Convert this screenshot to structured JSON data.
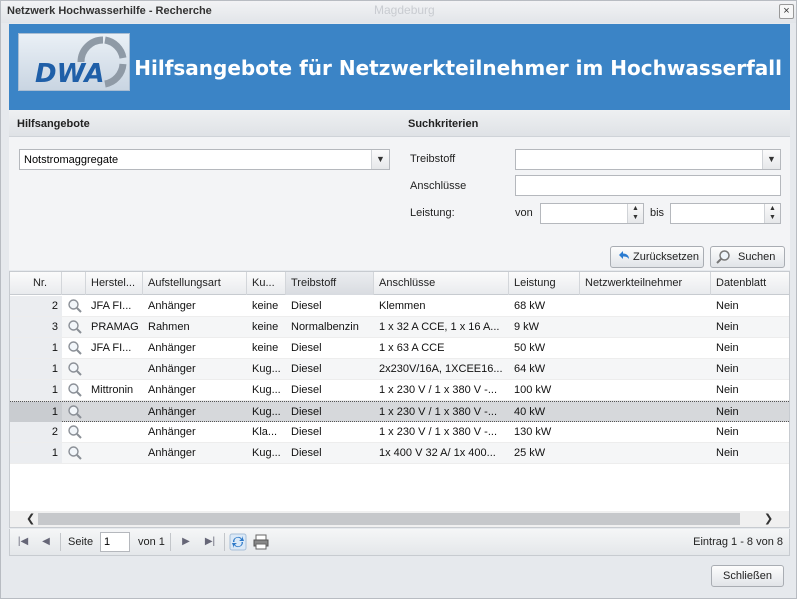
{
  "window": {
    "title": "Netzwerk Hochwasserhilfe - Recherche",
    "background_city": "Magdeburg",
    "close_label": "×"
  },
  "banner": {
    "logo_text": "DWA",
    "title": "Hilfsangebote für Netzwerkteilnehmer im Hochwasserfall"
  },
  "hilfsangebote": {
    "header": "Hilfsangebote",
    "selected": "Notstromaggregate"
  },
  "suchkriterien": {
    "header": "Suchkriterien",
    "treibstoff_label": "Treibstoff",
    "treibstoff_value": "",
    "anschluesse_label": "Anschlüsse",
    "anschluesse_value": "",
    "leistung_label": "Leistung:",
    "von_label": "von",
    "bis_label": "bis",
    "von_value": "",
    "bis_value": ""
  },
  "buttons": {
    "reset": "Zurücksetzen",
    "search": "Suchen",
    "close": "Schließen"
  },
  "grid": {
    "columns": [
      "Nr.",
      "",
      "Herstel...",
      "Aufstellungsart",
      "Ku...",
      "Treibstoff",
      "Anschlüsse",
      "Leistung",
      "Netzwerkteilnehmer",
      "Datenblatt"
    ],
    "rows": [
      {
        "nr": "2",
        "hersteller": "JFA FI...",
        "aufstellung": "Anhänger",
        "ku": "keine",
        "treibstoff": "Diesel",
        "anschluesse": "Klemmen",
        "leistung": "68 kW",
        "teilnehmer": "",
        "datenblatt": "Nein"
      },
      {
        "nr": "3",
        "hersteller": "PRAMAG",
        "aufstellung": "Rahmen",
        "ku": "keine",
        "treibstoff": "Normalbenzin",
        "anschluesse": "1 x 32 A CCE, 1 x 16 A...",
        "leistung": "9 kW",
        "teilnehmer": "",
        "datenblatt": "Nein"
      },
      {
        "nr": "1",
        "hersteller": "JFA FI...",
        "aufstellung": "Anhänger",
        "ku": "keine",
        "treibstoff": "Diesel",
        "anschluesse": "1 x 63 A CCE",
        "leistung": "50 kW",
        "teilnehmer": "",
        "datenblatt": "Nein"
      },
      {
        "nr": "1",
        "hersteller": "",
        "aufstellung": "Anhänger",
        "ku": "Kug...",
        "treibstoff": "Diesel",
        "anschluesse": "2x230V/16A, 1XCEE16...",
        "leistung": "64 kW",
        "teilnehmer": "",
        "datenblatt": "Nein"
      },
      {
        "nr": "1",
        "hersteller": "Mittronin",
        "aufstellung": "Anhänger",
        "ku": "Kug...",
        "treibstoff": "Diesel",
        "anschluesse": "1 x 230 V / 1 x 380 V -...",
        "leistung": "100 kW",
        "teilnehmer": "",
        "datenblatt": "Nein"
      },
      {
        "nr": "1",
        "hersteller": "",
        "aufstellung": "Anhänger",
        "ku": "Kug...",
        "treibstoff": "Diesel",
        "anschluesse": "1 x 230 V / 1 x 380 V -...",
        "leistung": "40 kW",
        "teilnehmer": "",
        "datenblatt": "Nein"
      },
      {
        "nr": "2",
        "hersteller": "",
        "aufstellung": "Anhänger",
        "ku": "Kla...",
        "treibstoff": "Diesel",
        "anschluesse": "1 x 230 V / 1 x 380 V -...",
        "leistung": "130 kW",
        "teilnehmer": "",
        "datenblatt": "Nein"
      },
      {
        "nr": "1",
        "hersteller": "",
        "aufstellung": "Anhänger",
        "ku": "Kug...",
        "treibstoff": "Diesel",
        "anschluesse": "1x 400 V 32 A/ 1x 400...",
        "leistung": "25 kW",
        "teilnehmer": "",
        "datenblatt": "Nein"
      }
    ],
    "selected_row": 5,
    "sorted_column": "Treibstoff"
  },
  "pager": {
    "page_label": "Seite",
    "page_value": "1",
    "of_label": "von 1",
    "status": "Eintrag 1 - 8 von 8"
  },
  "colors": {
    "banner": "#3b84c6",
    "selected_row": "#d6d8db"
  }
}
